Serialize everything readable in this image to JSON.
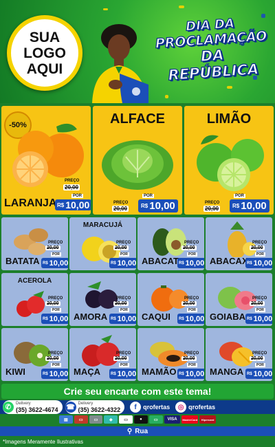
{
  "header": {
    "logo_lines": [
      "SUA",
      "LOGO",
      "AQUI"
    ],
    "title_lines": [
      "DIA DA",
      "PROCLAMAÇÃO",
      "DA REPÚBLICA"
    ]
  },
  "colors": {
    "green": "#1f8a2e",
    "yellow": "#f7c414",
    "blue_tile": "#9fb6de",
    "price_blue": "#1b4fb8",
    "navy": "#0d3a8a"
  },
  "featured": [
    {
      "name": "LARANJA",
      "title": "",
      "badge": "-50%",
      "preco": "PREÇO",
      "old": "20,00",
      "por": "POR",
      "currency": "R$",
      "price": "10,00",
      "icon": "orange-fruit-icon"
    },
    {
      "name": "",
      "title": "ALFACE",
      "badge": "",
      "preco": "PREÇO",
      "old": "20,00",
      "por": "POR",
      "currency": "R$",
      "price": "10,00",
      "icon": "lettuce-icon"
    },
    {
      "name": "",
      "title": "LIMÃO",
      "badge": "",
      "preco": "PREÇO",
      "old": "20,00",
      "por": "POR",
      "currency": "R$",
      "price": "10,00",
      "icon": "lime-icon"
    }
  ],
  "products": [
    {
      "name": "BATATA",
      "subtitle": "",
      "preco": "PREÇO",
      "old": "20,00",
      "por": "POR",
      "currency": "R$",
      "price": "10,00"
    },
    {
      "name": "",
      "subtitle": "MARACUJÁ",
      "preco": "PREÇO",
      "old": "20,00",
      "por": "POR",
      "currency": "R$",
      "price": "10,00"
    },
    {
      "name": "ABACATE",
      "subtitle": "",
      "preco": "PREÇO",
      "old": "20,00",
      "por": "POR",
      "currency": "R$",
      "price": "10,00"
    },
    {
      "name": "ABACAXI",
      "subtitle": "",
      "preco": "PREÇO",
      "old": "20,00",
      "por": "POR",
      "currency": "R$",
      "price": "10,00"
    },
    {
      "name": "",
      "subtitle": "ACEROLA",
      "preco": "PREÇO",
      "old": "20,00",
      "por": "POR",
      "currency": "R$",
      "price": "10,00"
    },
    {
      "name": "AMORA",
      "subtitle": "",
      "preco": "PREÇO",
      "old": "20,00",
      "por": "POR",
      "currency": "R$",
      "price": "10,00"
    },
    {
      "name": "CAQUI",
      "subtitle": "",
      "preco": "PREÇO",
      "old": "20,00",
      "por": "POR",
      "currency": "R$",
      "price": "10,00"
    },
    {
      "name": "GOIABA",
      "subtitle": "",
      "preco": "PREÇO",
      "old": "20,00",
      "por": "POR",
      "currency": "R$",
      "price": "10,00"
    },
    {
      "name": "KIWI",
      "subtitle": "",
      "preco": "PREÇO",
      "old": "20,00",
      "por": "POR",
      "currency": "R$",
      "price": "10,00"
    },
    {
      "name": "MAÇA",
      "subtitle": "",
      "preco": "PREÇO",
      "old": "20,00",
      "por": "POR",
      "currency": "R$",
      "price": "10,00"
    },
    {
      "name": "MAMÃO",
      "subtitle": "",
      "preco": "PREÇO",
      "old": "20,00",
      "por": "POR",
      "currency": "R$",
      "price": "10,00"
    },
    {
      "name": "MANGA",
      "subtitle": "",
      "preco": "PREÇO",
      "old": "20,00",
      "por": "POR",
      "currency": "R$",
      "price": "10,00"
    }
  ],
  "footer": {
    "promo": "Crie seu encarte com este tema!",
    "contact1_label": "Delivery",
    "contact1_number": "(35) 3622-4674",
    "contact2_label": "Delivery",
    "contact2_number": "(35) 3622-4322",
    "facebook": "qrofertas",
    "instagram": "qrofertas",
    "payments": [
      "VISA",
      "MasterCard",
      "Hipercard"
    ],
    "address": "Rua",
    "disclaimer": "*Imagens Meramente Ilustrativas"
  }
}
